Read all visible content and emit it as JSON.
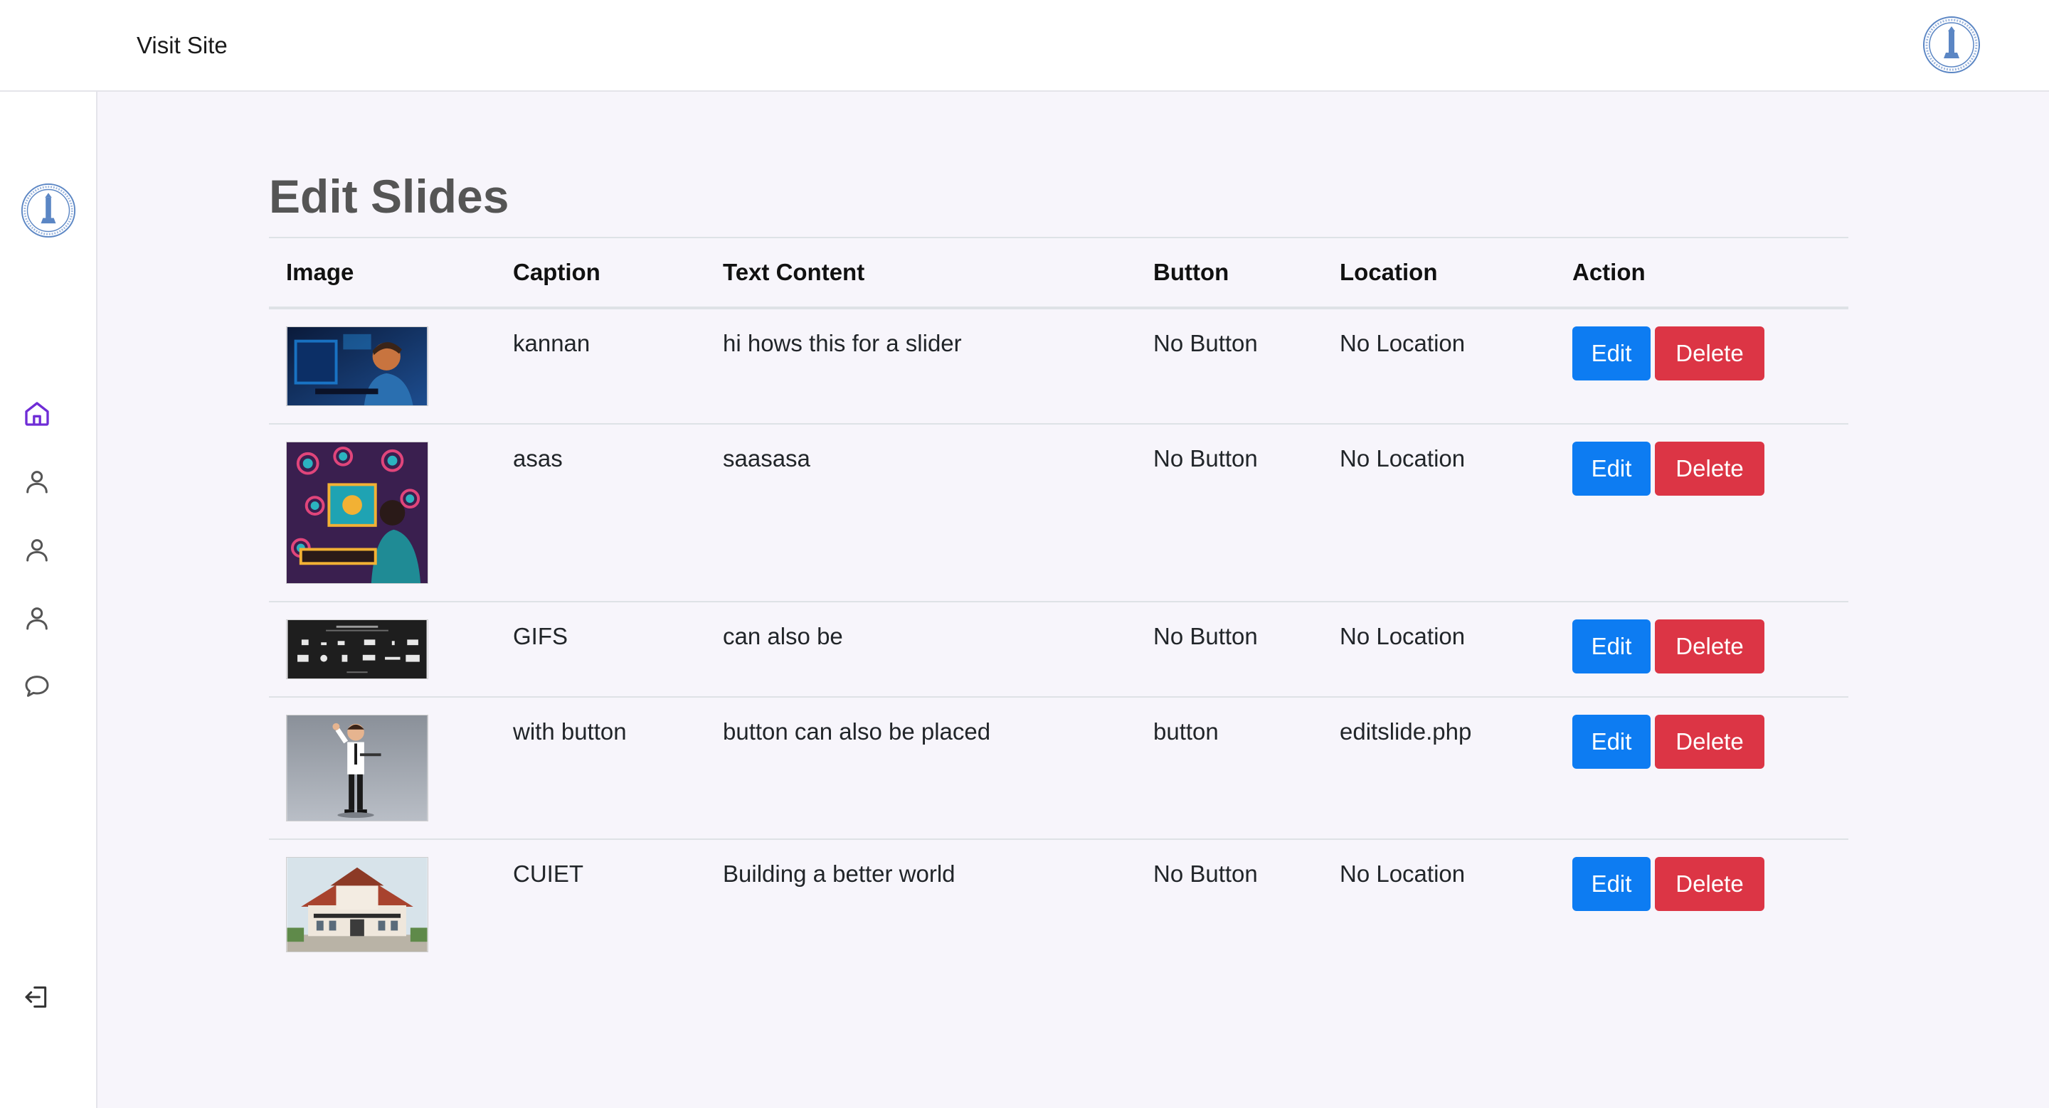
{
  "topbar": {
    "visit_site": "Visit Site",
    "logo_icon": "university-seal-icon"
  },
  "sidebar": {
    "logo_icon": "university-seal-icon",
    "nav": [
      {
        "icon": "home-icon",
        "active": true
      },
      {
        "icon": "user-icon"
      },
      {
        "icon": "user-icon"
      },
      {
        "icon": "user-icon"
      },
      {
        "icon": "chat-bubble-icon"
      }
    ],
    "logout_icon": "logout-icon"
  },
  "main": {
    "title": "Edit Slides",
    "columns": [
      "Image",
      "Caption",
      "Text Content",
      "Button",
      "Location",
      "Action"
    ],
    "rows": [
      {
        "image": "slide-thumbnail-developer-at-computer",
        "caption": "kannan",
        "text": "hi hows this for a slider",
        "button": "No Button",
        "location": "No Location",
        "edit": "Edit",
        "delete": "Delete"
      },
      {
        "image": "slide-thumbnail-gamer-colorful",
        "caption": "asas",
        "text": "saasasa",
        "button": "No Button",
        "location": "No Location",
        "edit": "Edit",
        "delete": "Delete"
      },
      {
        "image": "slide-thumbnail-ui-elements-dark",
        "caption": "GIFS",
        "text": "can also be",
        "button": "No Button",
        "location": "No Location",
        "edit": "Edit",
        "delete": "Delete"
      },
      {
        "image": "slide-thumbnail-man-with-laptop",
        "caption": "with button",
        "text": "button can also be placed",
        "button": "button",
        "location": "editslide.php",
        "edit": "Edit",
        "delete": "Delete"
      },
      {
        "image": "slide-thumbnail-building",
        "caption": "CUIET",
        "text": "Building a better world",
        "button": "No Button",
        "location": "No Location",
        "edit": "Edit",
        "delete": "Delete"
      }
    ]
  },
  "colors": {
    "accent_nav": "#6f2cd6",
    "edit_button": "#0d7cf2",
    "delete_button": "#dc3545",
    "page_background": "#f7f5fb"
  }
}
